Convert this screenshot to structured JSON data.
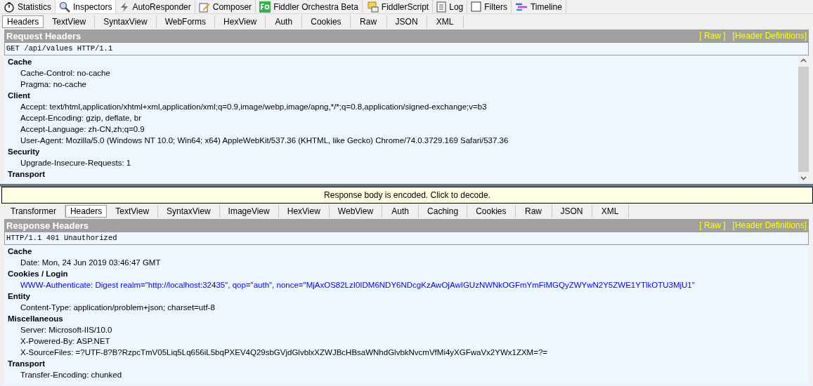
{
  "main_tabs": [
    {
      "label": "Statistics",
      "selected": false
    },
    {
      "label": "Inspectors",
      "selected": true
    },
    {
      "label": "AutoResponder",
      "selected": false
    },
    {
      "label": "Composer",
      "selected": false
    },
    {
      "label": "Fiddler Orchestra Beta",
      "selected": false
    },
    {
      "label": "FiddlerScript",
      "selected": false
    },
    {
      "label": "Log",
      "selected": false
    },
    {
      "label": "Filters",
      "selected": false
    },
    {
      "label": "Timeline",
      "selected": false
    }
  ],
  "request": {
    "tabs": [
      {
        "label": "Headers",
        "selected": true
      },
      {
        "label": "TextView",
        "selected": false
      },
      {
        "label": "SyntaxView",
        "selected": false
      },
      {
        "label": "WebForms",
        "selected": false
      },
      {
        "label": "HexView",
        "selected": false
      },
      {
        "label": "Auth",
        "selected": false
      },
      {
        "label": "Cookies",
        "selected": false
      },
      {
        "label": "Raw",
        "selected": false
      },
      {
        "label": "JSON",
        "selected": false
      },
      {
        "label": "XML",
        "selected": false
      }
    ],
    "title": "Request Headers",
    "links": [
      "[ Raw ]",
      "[Header Definitions]"
    ],
    "status_line": "GET /api/values HTTP/1.1",
    "groups": [
      {
        "name": "Cache",
        "items": [
          {
            "text": "Cache-Control: no-cache",
            "highlighted": false
          },
          {
            "text": "Pragma: no-cache",
            "highlighted": false
          }
        ]
      },
      {
        "name": "Client",
        "items": [
          {
            "text": "Accept: text/html,application/xhtml+xml,application/xml;q=0.9,image/webp,image/apng,*/*;q=0.8,application/signed-exchange;v=b3",
            "highlighted": false
          },
          {
            "text": "Accept-Encoding: gzip, deflate, br",
            "highlighted": false
          },
          {
            "text": "Accept-Language: zh-CN,zh;q=0.9",
            "highlighted": false
          },
          {
            "text": "User-Agent: Mozilla/5.0 (Windows NT 10.0; Win64; x64) AppleWebKit/537.36 (KHTML, like Gecko) Chrome/74.0.3729.169 Safari/537.36",
            "highlighted": false
          }
        ]
      },
      {
        "name": "Security",
        "items": [
          {
            "text": "Upgrade-Insecure-Requests: 1",
            "highlighted": false
          }
        ]
      },
      {
        "name": "Transport"
      }
    ]
  },
  "notice": "Response body is encoded. Click to decode.",
  "response": {
    "tabs": [
      {
        "label": "Transformer",
        "selected": false
      },
      {
        "label": "Headers",
        "selected": true
      },
      {
        "label": "TextView",
        "selected": false
      },
      {
        "label": "SyntaxView",
        "selected": false
      },
      {
        "label": "ImageView",
        "selected": false
      },
      {
        "label": "HexView",
        "selected": false
      },
      {
        "label": "WebView",
        "selected": false
      },
      {
        "label": "Auth",
        "selected": false
      },
      {
        "label": "Caching",
        "selected": false
      },
      {
        "label": "Cookies",
        "selected": false
      },
      {
        "label": "Raw",
        "selected": false
      },
      {
        "label": "JSON",
        "selected": false
      },
      {
        "label": "XML",
        "selected": false
      }
    ],
    "title": "Response Headers",
    "links": [
      "[ Raw ]",
      "[Header Definitions]"
    ],
    "status_line": "HTTP/1.1 401 Unauthorized",
    "groups": [
      {
        "name": "Cache",
        "items": [
          {
            "text": "Date: Mon, 24 Jun 2019 03:46:47 GMT",
            "highlighted": false
          }
        ]
      },
      {
        "name": "Cookies / Login",
        "items": [
          {
            "text": "WWW-Authenticate: Digest realm=\"http://localhost:32435\", qop=\"auth\", nonce=\"MjAxOS82LzI0IDM6NDY6NDcgKzAwOjAwIGUzNWNkOGFmYmFiMGQyZWYwN2Y5ZWE1YTlkOTU3MjU1\"",
            "highlighted": true
          }
        ]
      },
      {
        "name": "Entity",
        "items": [
          {
            "text": "Content-Type: application/problem+json; charset=utf-8",
            "highlighted": false
          }
        ]
      },
      {
        "name": "Miscellaneous",
        "items": [
          {
            "text": "Server: Microsoft-IIS/10.0",
            "highlighted": false
          },
          {
            "text": "X-Powered-By: ASP.NET",
            "highlighted": false
          },
          {
            "text": "X-SourceFiles: =?UTF-8?B?RzpcTmV05Liq5Lq656iL5bqPXEV4Q29sbGVjdGlvblxXZWJBcHBsaWNhdGlvbkNvcmVfMi4yXGFwaVx2YWx1ZXM=?=",
            "highlighted": false
          }
        ]
      },
      {
        "name": "Transport",
        "items": [
          {
            "text": "Transfer-Encoding: chunked",
            "highlighted": false
          }
        ]
      }
    ]
  }
}
